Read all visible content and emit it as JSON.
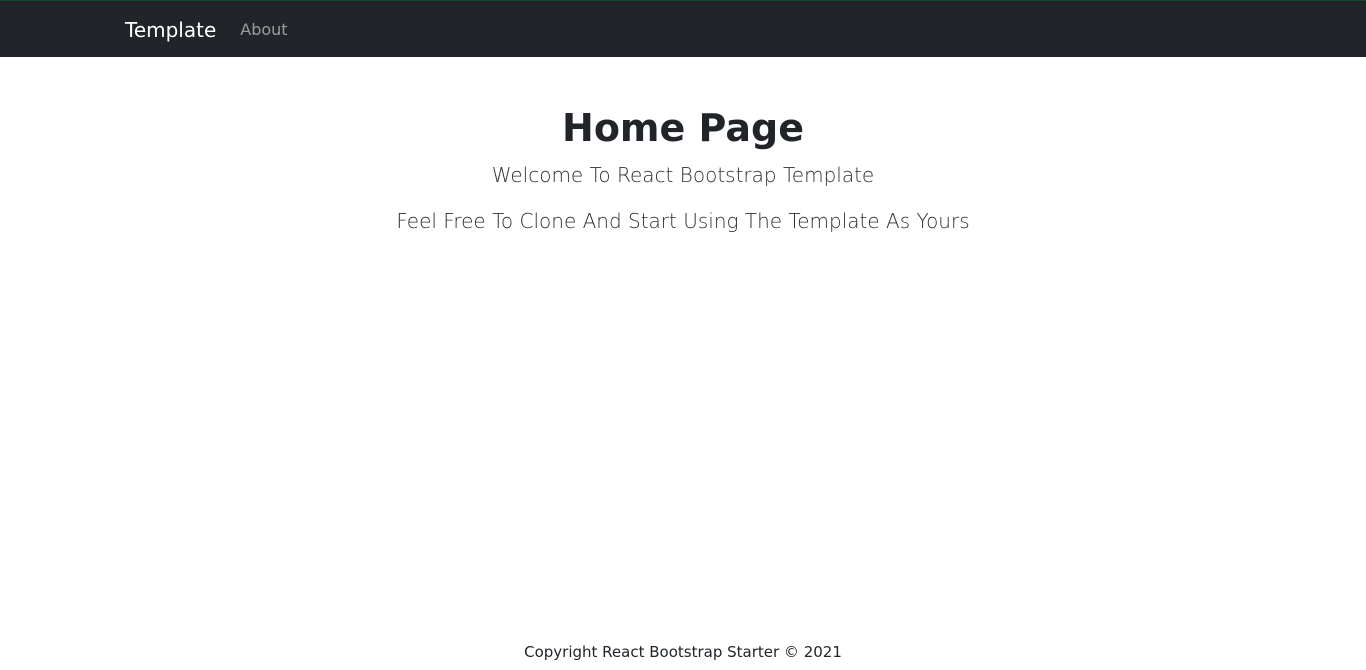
{
  "navbar": {
    "brand": "Template",
    "links": [
      {
        "label": "About"
      }
    ]
  },
  "main": {
    "title": "Home Page",
    "subtitle": "Welcome To React Bootstrap Template",
    "description": "Feel Free To Clone And Start Using The Template As Yours"
  },
  "footer": {
    "text": "Copyright React Bootstrap Starter © 2021"
  },
  "colors": {
    "navbar_bg": "#212529",
    "brand": "#ffffff",
    "nav_link": "#9a9da0",
    "text": "#212529"
  }
}
